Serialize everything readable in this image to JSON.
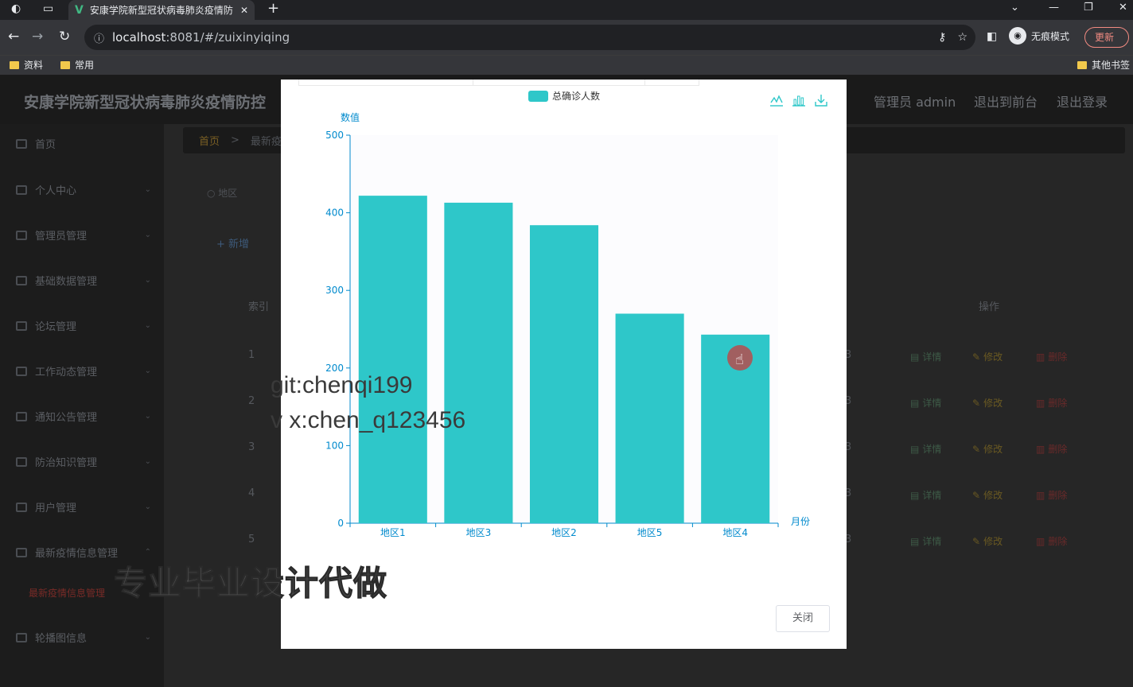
{
  "browser": {
    "tab_title": "安康学院新型冠状病毒肺炎疫情防",
    "url_host": "localhost",
    "url_rest": ":8081/#/zuixinyiqing",
    "incognito_label": "无痕模式",
    "update_label": "更新",
    "bookmarks": [
      "资料",
      "常用"
    ],
    "other_bookmarks": "其他书签"
  },
  "app": {
    "title": "安康学院新型冠状病毒肺炎疫情防控",
    "admin_label": "管理员 admin",
    "front_label": "退出到前台",
    "logout_label": "退出登录"
  },
  "sidebar": {
    "items": [
      {
        "label": "首页"
      },
      {
        "label": "个人中心"
      },
      {
        "label": "管理员管理"
      },
      {
        "label": "基础数据管理"
      },
      {
        "label": "论坛管理"
      },
      {
        "label": "工作动态管理"
      },
      {
        "label": "通知公告管理"
      },
      {
        "label": "防治知识管理"
      },
      {
        "label": "用户管理"
      },
      {
        "label": "最新疫情信息管理"
      },
      {
        "label": "轮播图信息"
      }
    ],
    "active_sub": "最新疫情信息管理"
  },
  "main": {
    "breadcrumb_home": "首页",
    "breadcrumb_sep": ">",
    "breadcrumb_current": "最新疫",
    "search_placeholder": "地区",
    "add_label": "新增",
    "col_index": "索引",
    "col_ops": "操作",
    "rows": [
      "1",
      "2",
      "3",
      "4",
      "5"
    ],
    "row_tail": "3",
    "action_detail": "详情",
    "action_edit": "修改",
    "action_delete": "删除"
  },
  "modal": {
    "close_label": "关闭"
  },
  "chart_data": {
    "type": "bar",
    "legend": [
      "总确诊人数"
    ],
    "categories": [
      "地区1",
      "地区3",
      "地区2",
      "地区5",
      "地区4"
    ],
    "series": [
      {
        "name": "总确诊人数",
        "values": [
          422,
          413,
          384,
          270,
          243
        ]
      }
    ],
    "ylabel": "数值",
    "xlabel": "月份",
    "ylim": [
      0,
      500
    ],
    "yticks": [
      0,
      100,
      200,
      300,
      400,
      500
    ],
    "bar_color": "#2ec7c9",
    "axis_color": "#008acd",
    "legend_position": "top-center",
    "toolbox": [
      "line-chart-icon",
      "bar-chart-icon",
      "download-icon"
    ]
  },
  "overlay": {
    "watermark_line1": "git:chenqi199",
    "watermark_line2": "v x:chen_q123456",
    "promo_text": "专业毕业设计代做"
  }
}
